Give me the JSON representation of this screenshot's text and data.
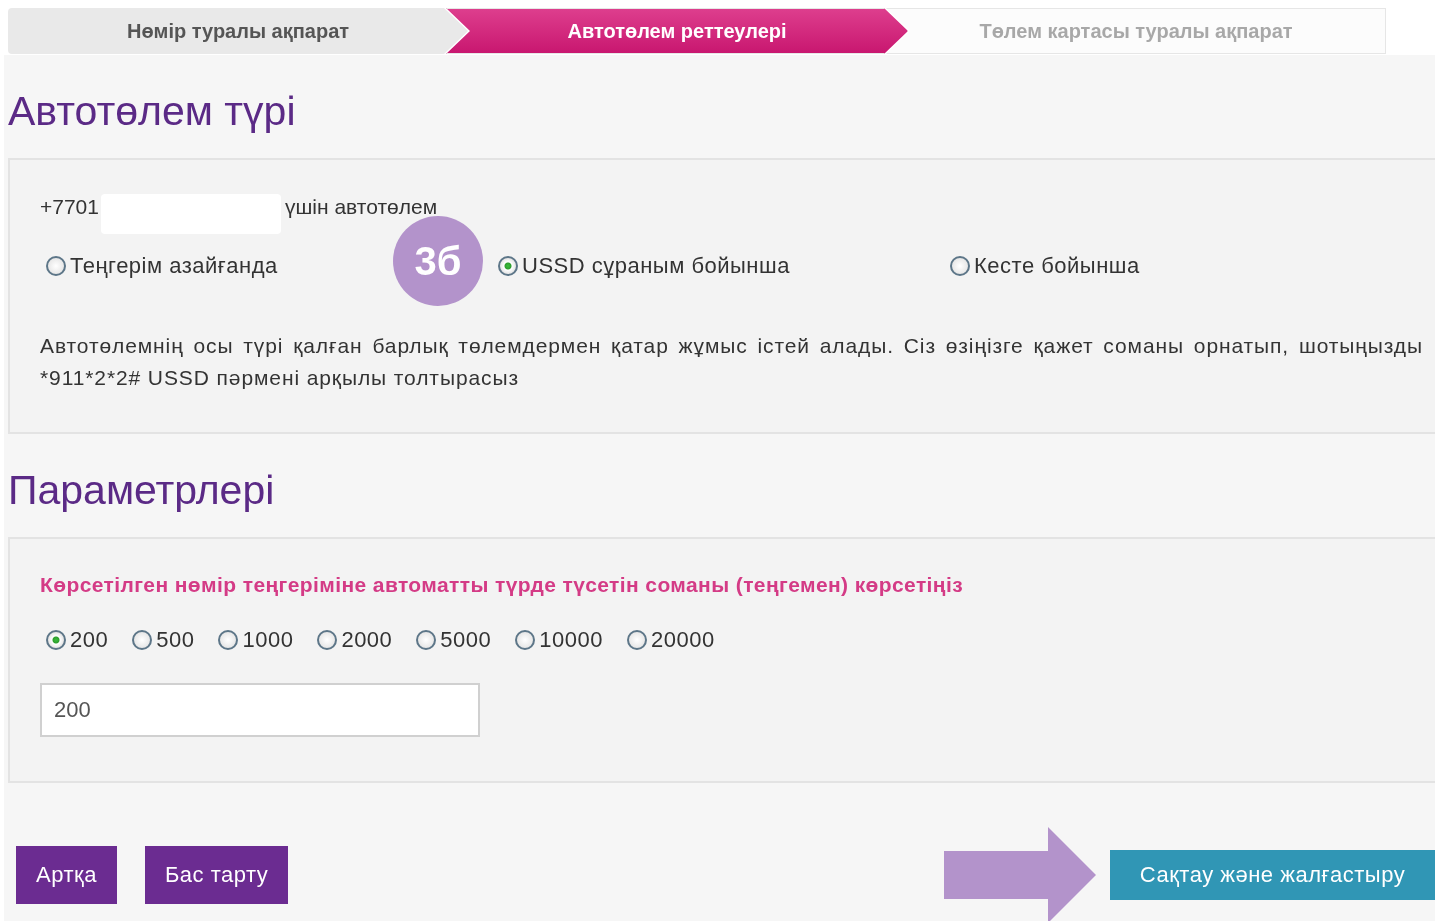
{
  "steps": [
    {
      "label": "Нөмір туралы ақпарат",
      "selected": false,
      "completed": true
    },
    {
      "label": "Автотөлем реттеулері",
      "selected": true,
      "completed": false
    },
    {
      "label": "Төлем картасы туралы ақпарат",
      "selected": false,
      "completed": false
    }
  ],
  "autopay_type": {
    "title": "Автотөлем түрі",
    "number_prefix": "+7701",
    "number_suffix": "үшін автотөлем",
    "options": [
      {
        "label": "Теңгерім азайғанда",
        "selected": false
      },
      {
        "label": "USSD сұраным бойынша",
        "selected": true
      },
      {
        "label": "Кесте бойынша",
        "selected": false
      }
    ],
    "description": "Автотөлемнің осы түрі қалған барлық төлемдермен қатар жұмыс істей алады. Сіз өзіңізге қажет соманы орнатып, шотыңызды *911*2*2# USSD пәрмені арқылы толтырасыз"
  },
  "annotation": {
    "label": "3б"
  },
  "parameters": {
    "title": "Параметрлері",
    "prompt": "Көрсетілген нөмір теңгеріміне автоматты түрде түсетін соманы (теңгемен) көрсетіңіз",
    "amounts": [
      {
        "label": "200",
        "selected": true
      },
      {
        "label": "500",
        "selected": false
      },
      {
        "label": "1000",
        "selected": false
      },
      {
        "label": "2000",
        "selected": false
      },
      {
        "label": "5000",
        "selected": false
      },
      {
        "label": "10000",
        "selected": false
      },
      {
        "label": "20000",
        "selected": false
      }
    ],
    "amount_field": {
      "value": "200"
    }
  },
  "buttons": {
    "back": "Артқа",
    "cancel": "Бас тарту",
    "save": "Сақтау және жалғастыру"
  }
}
